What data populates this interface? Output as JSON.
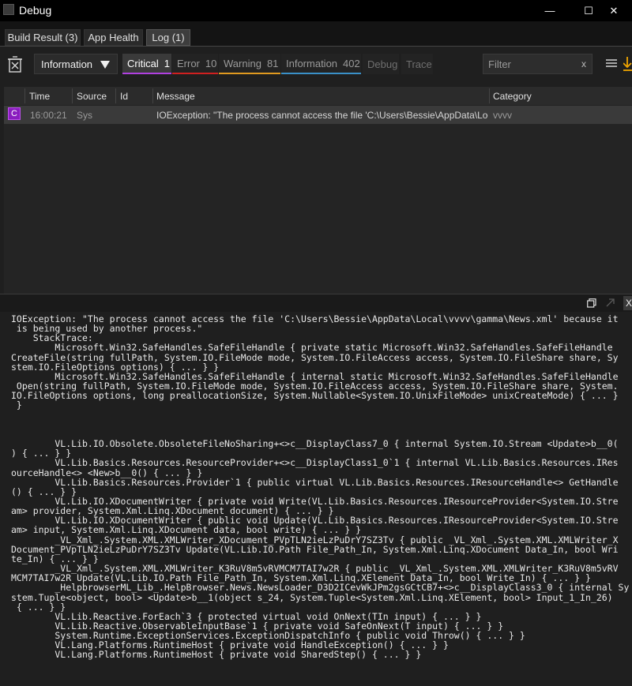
{
  "window": {
    "title": "Debug",
    "minimize_glyph": "—",
    "maximize_glyph": "☐",
    "close_glyph": "✕"
  },
  "tabs": [
    {
      "label": "Build Result (3)"
    },
    {
      "label": "App Health"
    },
    {
      "label": "Log (1)",
      "active": true
    }
  ],
  "toolbar": {
    "clear_icon": "trash-icon",
    "level_dropdown": "Information",
    "filters": [
      {
        "label": "Critical",
        "count": "1",
        "color": "#b040e0"
      },
      {
        "label": "Error",
        "count": "10",
        "color": "#d02020"
      },
      {
        "label": "Warning",
        "count": "81",
        "color": "#e09a20"
      },
      {
        "label": "Information",
        "count": "402",
        "color": "#3a90c8"
      },
      {
        "label": "Debug",
        "count": ""
      },
      {
        "label": "Trace",
        "count": ""
      }
    ],
    "search_placeholder": "Filter",
    "search_clear": "x"
  },
  "grid": {
    "columns": [
      "Time",
      "Source",
      "Id",
      "Message",
      "Category"
    ],
    "rows": [
      {
        "badge": "C",
        "time": "16:00:21",
        "source": "Sys",
        "id": "",
        "message": "IOException: \"The process cannot access the file 'C:\\Users\\Bessie\\AppData\\Local\\vvvv\\gamma\\News.xml' because it is being used by another process.\"",
        "category": "vvvv"
      }
    ]
  },
  "details": {
    "close_glyph": "X",
    "text": "IOException: \"The process cannot access the file 'C:\\Users\\Bessie\\AppData\\Local\\vvvv\\gamma\\News.xml' because it\n is being used by another process.\"\n    StackTrace:\n        Microsoft.Win32.SafeHandles.SafeFileHandle { private static Microsoft.Win32.SafeHandles.SafeFileHandle\nCreateFile(string fullPath, System.IO.FileMode mode, System.IO.FileAccess access, System.IO.FileShare share, Sy\nstem.IO.FileOptions options) { ... } }\n        Microsoft.Win32.SafeHandles.SafeFileHandle { internal static Microsoft.Win32.SafeHandles.SafeFileHandle\n Open(string fullPath, System.IO.FileMode mode, System.IO.FileAccess access, System.IO.FileShare share, System.\nIO.FileOptions options, long preallocationSize, System.Nullable<System.IO.UnixFileMode> unixCreateMode) { ... }\n }\n\n\n\n        VL.Lib.IO.Obsolete.ObsoleteFileNoSharing+<>c__DisplayClass7_0 { internal System.IO.Stream <Update>b__0(\n) { ... } }\n        VL.Lib.Basics.Resources.ResourceProvider+<>c__DisplayClass1_0`1 { internal VL.Lib.Basics.Resources.IRes\nourceHandle<> <New>b__0() { ... } }\n        VL.Lib.Basics.Resources.Provider`1 { public virtual VL.Lib.Basics.Resources.IResourceHandle<> GetHandle\n() { ... } }\n        VL.Lib.IO.XDocumentWriter { private void Write(VL.Lib.Basics.Resources.IResourceProvider<System.IO.Stre\nam> provider, System.Xml.Linq.XDocument document) { ... } }\n        VL.Lib.IO.XDocumentWriter { public void Update(VL.Lib.Basics.Resources.IResourceProvider<System.IO.Stre\nam> input, System.Xml.Linq.XDocument data, bool write) { ... } }\n        _VL_Xml_.System.XML.XMLWriter_XDocument_PVpTLN2ieLzPuDrY7SZ3Tv { public _VL_Xml_.System.XML.XMLWriter_X\nDocument_PVpTLN2ieLzPuDrY7SZ3Tv Update(VL.Lib.IO.Path File_Path_In, System.Xml.Linq.XDocument Data_In, bool Wri\nte_In) { ... } }\n        _VL_Xml_.System.XML.XMLWriter_K3RuV8m5vRVMCM7TAI7w2R { public _VL_Xml_.System.XML.XMLWriter_K3RuV8m5vRV\nMCM7TAI7w2R Update(VL.Lib.IO.Path File_Path_In, System.Xml.Linq.XElement Data_In, bool Write_In) { ... } }\n        _HelpbrowserML_Lib_.HelpBrowser.News.NewsLoader_D3D2ICevWkJPm2gsGCtCB7+<>c__DisplayClass3_0 { internal Sy\nstem.Tuple<object, bool> <Update>b__1(object s_24, System.Tuple<System.Xml.Linq.XElement, bool> Input_1_In_26)\n { ... } }\n        VL.Lib.Reactive.ForEach`3 { protected virtual void OnNext(TIn input) { ... } }\n        VL.Lib.Reactive.ObservableInputBase`1 { private void SafeOnNext(T input) { ... } }\n        System.Runtime.ExceptionServices.ExceptionDispatchInfo { public void Throw() { ... } }\n        VL.Lang.Platforms.RuntimeHost { private void HandleException() { ... } }\n        VL.Lang.Platforms.RuntimeHost { private void SharedStep() { ... } }"
  }
}
